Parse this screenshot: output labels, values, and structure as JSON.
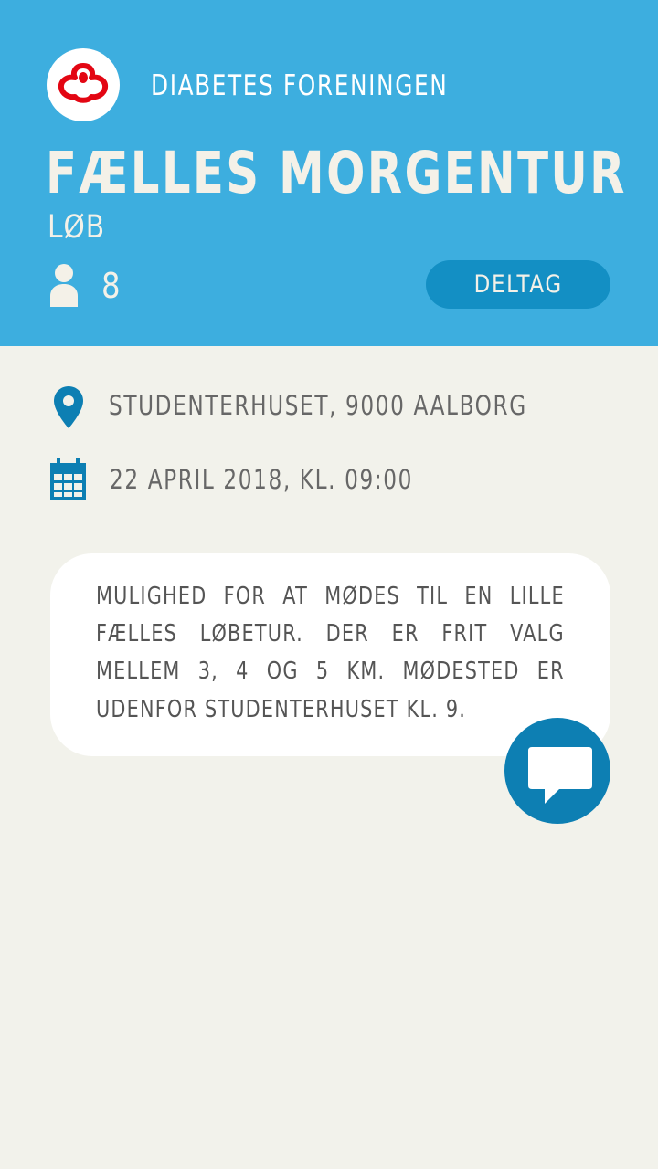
{
  "header": {
    "org_name": "DIABETES FORENINGEN",
    "title": "FÆLLES MORGENTUR",
    "activity": "LØB",
    "participants": "8",
    "join_label": "DELTAG"
  },
  "details": {
    "location": "STUDENTERHUSET, 9000 AALBORG",
    "datetime": "22 APRIL 2018, KL. 09:00"
  },
  "description": {
    "lines": [
      "MULIGHED FOR AT MØDES TIL EN LILLE",
      "FÆLLES LØBETUR. DER ER FRIT VALG",
      "MELLEM 3, 4 OG 5 KM. MØDESTED ER",
      "UDENFOR STUDENTERHUSET KL. 9."
    ]
  },
  "icons": {
    "logo": "diabetes-foreningen-logo",
    "person": "person-icon",
    "pin": "map-pin-icon",
    "calendar": "calendar-icon",
    "chat": "chat-bubble-icon"
  },
  "colors": {
    "header_bg": "#3daedf",
    "button_bg": "#138fc4",
    "icon_blue": "#0d7fb3",
    "page_bg": "#f2f2eb",
    "logo_red": "#e30613"
  }
}
